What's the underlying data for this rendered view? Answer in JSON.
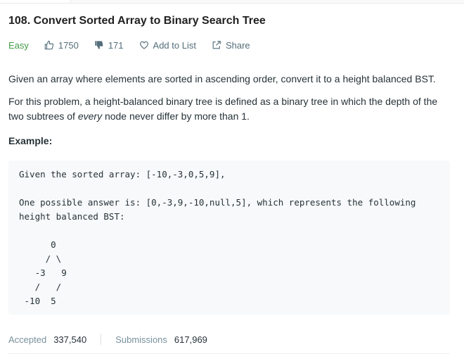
{
  "problem": {
    "title": "108. Convert Sorted Array to Binary Search Tree",
    "difficulty": "Easy",
    "likes": "1750",
    "dislikes": "171",
    "add_to_list": "Add to List",
    "share": "Share"
  },
  "description": {
    "p1": "Given an array where elements are sorted in ascending order, convert it to a height balanced BST.",
    "p2_before": "For this problem, a height-balanced binary tree is defined as a binary tree in which the depth of the two subtrees of ",
    "p2_em": "every",
    "p2_after": " node never differ by more than 1.",
    "example_label": "Example:"
  },
  "example_code": [
    "Given the sorted array: [-10,-3,0,5,9],",
    "",
    "One possible answer is: [0,-3,9,-10,null,5], which represents the following",
    "height balanced BST:",
    "",
    "      0",
    "     / \\",
    "   -3   9",
    "   /   /",
    " -10  5"
  ],
  "stats": {
    "accepted_label": "Accepted",
    "accepted_value": "337,540",
    "submissions_label": "Submissions",
    "submissions_value": "617,969"
  },
  "colors": {
    "easy": "#43a047",
    "meta_text": "#546e7a",
    "code_bg": "#f7f9fa"
  },
  "icons": [
    "thumbs-up-icon",
    "thumbs-down-icon",
    "heart-icon",
    "share-icon"
  ]
}
